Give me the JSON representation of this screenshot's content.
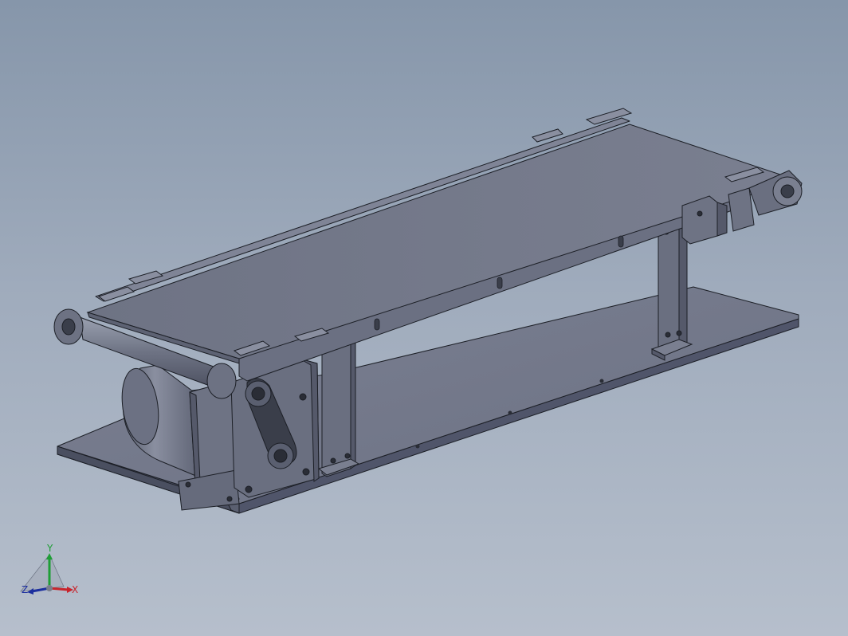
{
  "viewport": {
    "background_top": "#8696aa",
    "background_bottom": "#b6bfcc",
    "model_color": "#6e7386",
    "edge_color": "#1c1f26"
  },
  "triad": {
    "y_label": "Y",
    "z_label": "Z",
    "x_label": "X",
    "colors": {
      "x": "#c8242c",
      "y": "#1e9e36",
      "z": "#1c2f9e"
    }
  }
}
